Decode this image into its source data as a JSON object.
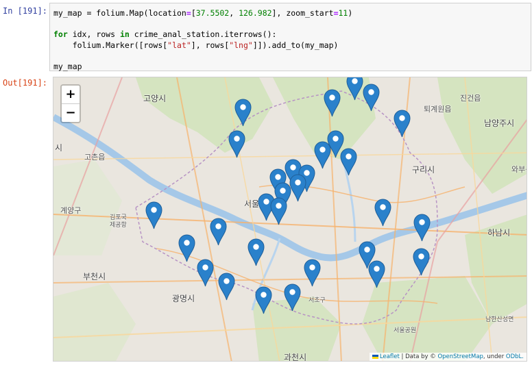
{
  "cell_in": {
    "prompt": "In [191]:"
  },
  "code": {
    "l1_a": "my_map = folium.Map(location",
    "l1_eq": "=",
    "l1_b": "[",
    "l1_n1": "37.5502",
    "l1_c": ", ",
    "l1_n2": "126.982",
    "l1_d": "], zoom_start",
    "l1_eq2": "=",
    "l1_n3": "11",
    "l1_e": ")",
    "l3_kw1": "for",
    "l3_a": " idx, rows ",
    "l3_kw2": "in",
    "l3_b": " crime_anal_station.iterrows():",
    "l4_a": "    folium.Marker([rows[",
    "l4_s1": "\"lat\"",
    "l4_b": "], rows[",
    "l4_s2": "\"lng\"",
    "l4_c": "]]).add_to(my_map)",
    "l6": "my_map"
  },
  "cell_out": {
    "prompt": "Out[191]:"
  },
  "map": {
    "zoom_in": "+",
    "zoom_out": "−",
    "labels": {
      "goyang": "고양시",
      "namyangju": "남양주시",
      "guri": "구리시",
      "hanam": "하남시",
      "bucheon": "부천시",
      "gwangmyeong": "광명시",
      "gwacheon": "과천시",
      "seoul": "서울",
      "gimpo": "김포국제공항",
      "toegye": "퇴계원읍",
      "jingeon": "진건읍",
      "goneup": "고촌읍",
      "gyeyang": "계양구",
      "namhansanseong": "남한산성면",
      "seoulgongwon": "서울공원",
      "wabu": "와부읍",
      "seocho": "서초구",
      "si_left": "시"
    },
    "marker_color": "#2a81cb",
    "marker_count": 30,
    "attribution": {
      "leaflet": "Leaflet",
      "data_by": " | Data by © ",
      "osm": "OpenStreetMap",
      "under": ", under ",
      "odbl": "ODbL."
    }
  }
}
